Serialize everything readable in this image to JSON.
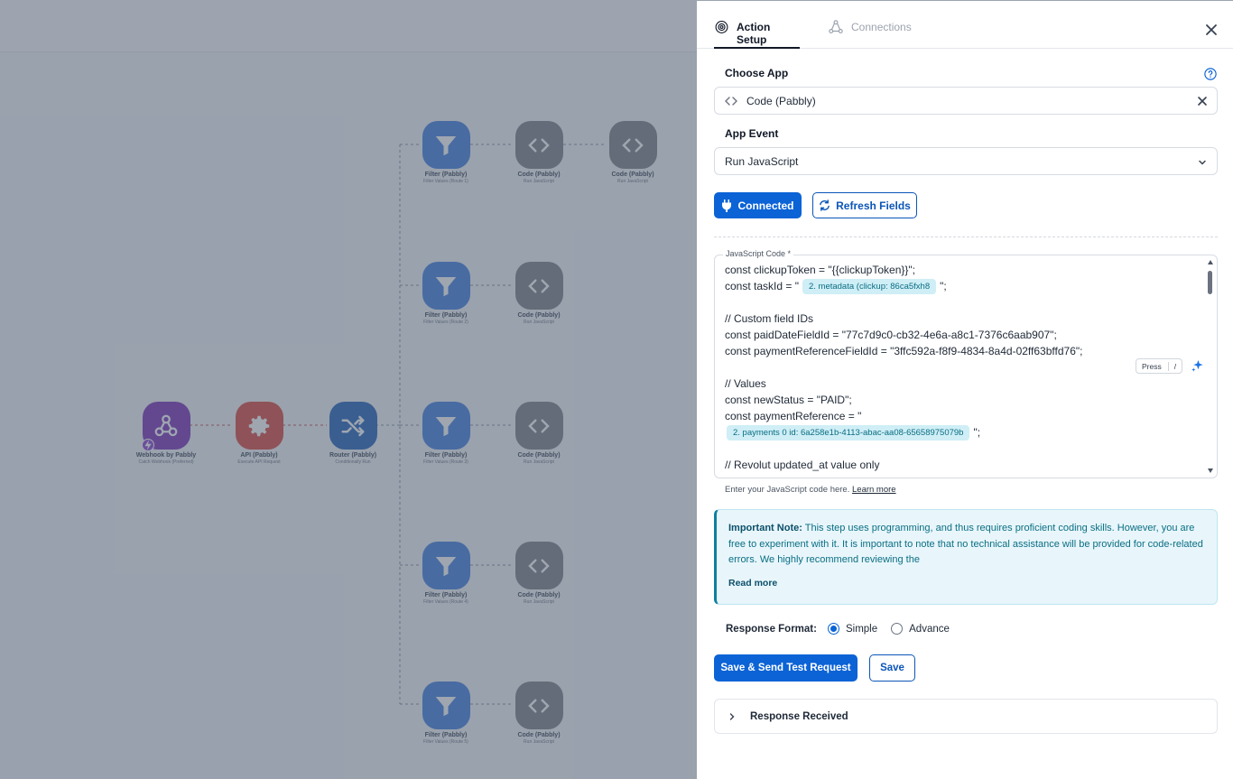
{
  "canvas": {
    "nodes": {
      "webhook": {
        "title": "Webhook by Pabbly",
        "sub": "Catch Webhook (Preferred)"
      },
      "api": {
        "title": "API (Pabbly)",
        "sub": "Execute API Request"
      },
      "router": {
        "title": "Router (Pabbly)",
        "sub": "Conditionally Run"
      },
      "filter1": {
        "title": "Filter (Pabbly)",
        "sub": "Filter Values (Route 1)"
      },
      "code1a": {
        "title": "Code (Pabbly)",
        "sub": "Run JavaScript"
      },
      "code1b": {
        "title": "Code (Pabbly)",
        "sub": "Run JavaScript"
      },
      "filter2": {
        "title": "Filter (Pabbly)",
        "sub": "Filter Values (Route 2)"
      },
      "code2": {
        "title": "Code (Pabbly)",
        "sub": "Run JavaScript"
      },
      "filter3": {
        "title": "Filter (Pabbly)",
        "sub": "Filter Values (Route 3)"
      },
      "code3": {
        "title": "Code (Pabbly)",
        "sub": "Run JavaScript"
      },
      "filter4": {
        "title": "Filter (Pabbly)",
        "sub": "Filter Values (Route 4)"
      },
      "code4": {
        "title": "Code (Pabbly)",
        "sub": "Run JavaScript"
      },
      "filter5": {
        "title": "Filter (Pabbly)",
        "sub": "Filter Values (Route 5)"
      },
      "code5": {
        "title": "Code (Pabbly)",
        "sub": "Run JavaScript"
      }
    }
  },
  "panel": {
    "tabs": {
      "action_setup": "Action Setup",
      "connections": "Connections"
    },
    "choose_app_label": "Choose App",
    "app_value": "Code (Pabbly)",
    "app_event_label": "App Event",
    "app_event_value": "Run JavaScript",
    "connected_label": "Connected",
    "refresh_label": "Refresh Fields",
    "code_label": "JavaScript Code *",
    "code": {
      "l1": "const clickupToken = \"{{clickupToken}}\";",
      "l2_pre": "const taskId = \"",
      "l2_chip": "2. metadata (clickup: 86ca5fxh8",
      "l2_post": "\";",
      "l3": "// Custom field IDs",
      "l4": "const paidDateFieldId = \"77c7d9c0-cb32-4e6a-a8c1-7376c6aab907\";",
      "l5": "const paymentReferenceFieldId = \"3ffc592a-f8f9-4834-8a4d-02ff63bffd76\";",
      "l6": "// Values",
      "l7": "const newStatus = \"PAID\";",
      "l8": "const paymentReference = \"",
      "l9_chip": "2. payments 0 id: 6a258e1b-4113-abac-aa08-65658975079b",
      "l9_post": "\";",
      "l10": "// Revolut updated_at value only"
    },
    "press_label": "Press",
    "press_key": "/",
    "help_text": "Enter your JavaScript code here.",
    "learn_more": "Learn more",
    "note": {
      "title": "Important Note:",
      "body": " This step uses programming, and thus requires proficient coding skills. However, you are free to experiment with it. It is important to note that no technical assistance will be provided for code-related errors. We highly recommend reviewing the",
      "read_more": "Read more"
    },
    "response_format": {
      "label": "Response Format:",
      "simple": "Simple",
      "advance": "Advance"
    },
    "save_send_label": "Save & Send Test Request",
    "save_label": "Save",
    "response_received": "Response Received"
  }
}
